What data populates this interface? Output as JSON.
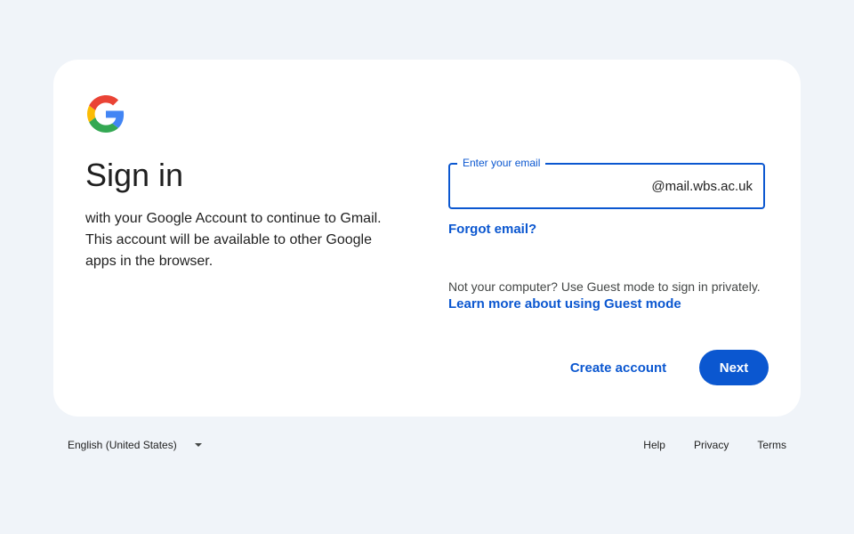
{
  "brand": {
    "logo_icon": "google-g-logo-icon",
    "colors": {
      "blue": "#4285F4",
      "red": "#EA4335",
      "yellow": "#FBBC05",
      "green": "#34A853",
      "accent": "#0b57d0"
    }
  },
  "signin": {
    "title": "Sign in",
    "subtitle": "with your Google Account to continue to Gmail. This account will be available to other Google apps in the browser."
  },
  "email": {
    "label": "Enter your email",
    "value": "",
    "suffix": "@mail.wbs.ac.uk"
  },
  "links": {
    "forgot_email": "Forgot email?",
    "guest_text": "Not your computer? Use Guest mode to sign in privately.",
    "guest_link": "Learn more about using Guest mode"
  },
  "actions": {
    "create_account": "Create account",
    "next": "Next"
  },
  "footer": {
    "language": "English (United States)",
    "language_caret_icon": "caret-down-icon",
    "links": [
      "Help",
      "Privacy",
      "Terms"
    ]
  }
}
